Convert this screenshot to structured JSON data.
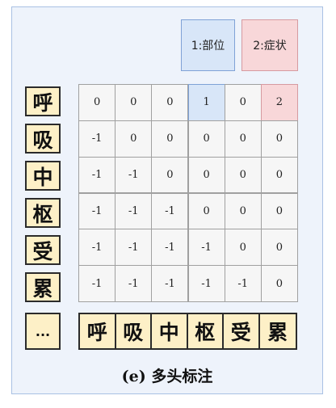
{
  "legend": {
    "position_label": "1:部位",
    "symptom_label": "2:症状"
  },
  "row_tokens": [
    "呼",
    "吸",
    "中",
    "枢",
    "受",
    "累"
  ],
  "ellipsis": "...",
  "col_tokens": [
    "呼",
    "吸",
    "中",
    "枢",
    "受",
    "累"
  ],
  "matrix": [
    [
      "0",
      "0",
      "0",
      "1",
      "0",
      "2"
    ],
    [
      "-1",
      "0",
      "0",
      "0",
      "0",
      "0"
    ],
    [
      "-1",
      "-1",
      "0",
      "0",
      "0",
      "0"
    ],
    [
      "-1",
      "-1",
      "-1",
      "0",
      "0",
      "0"
    ],
    [
      "-1",
      "-1",
      "-1",
      "-1",
      "0",
      "0"
    ],
    [
      "-1",
      "-1",
      "-1",
      "-1",
      "-1",
      "0"
    ]
  ],
  "caption": "(e) 多头标注",
  "colors": {
    "position": "#d8e6f8",
    "symptom": "#f8d7d9",
    "token": "#fdf0c7",
    "background": "#eef3fb"
  }
}
